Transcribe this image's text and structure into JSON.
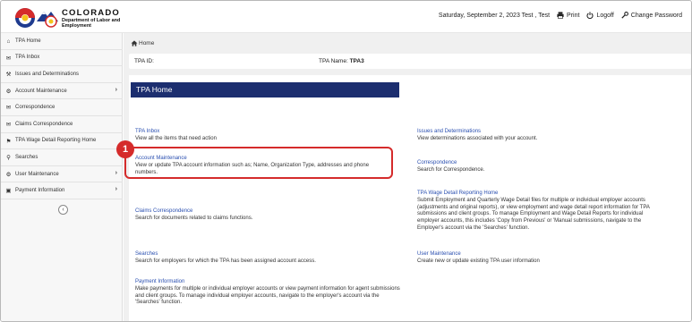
{
  "header": {
    "logo_title": "COLORADO",
    "logo_subtitle": "Department of Labor and Employment",
    "date_user": "Saturday, September 2, 2023  Test , Test",
    "print_label": "Print",
    "logoff_label": "Logoff",
    "change_password_label": "Change Password"
  },
  "sidebar": {
    "items": [
      {
        "label": "TPA Home",
        "icon": "home-icon"
      },
      {
        "label": "TPA Inbox",
        "icon": "envelope-icon"
      },
      {
        "label": "Issues and Determinations",
        "icon": "wrench-icon"
      },
      {
        "label": "Account Maintenance",
        "icon": "cogs-icon"
      },
      {
        "label": "Correspondence",
        "icon": "envelope-icon"
      },
      {
        "label": "Claims Correspondence",
        "icon": "envelope-icon"
      },
      {
        "label": "TPA Wage Detail Reporting Home",
        "icon": "flag-icon"
      },
      {
        "label": "Searches",
        "icon": "search-icon"
      },
      {
        "label": "User Maintenance",
        "icon": "cogs-icon"
      },
      {
        "label": "Payment Information",
        "icon": "money-icon"
      }
    ]
  },
  "breadcrumb": {
    "home_label": "Home"
  },
  "tpa_bar": {
    "id_label": "TPA ID:",
    "name_label": "TPA Name:",
    "name_value": "TPA3"
  },
  "page_title": "TPA Home",
  "callout_number": "1",
  "left_column": [
    {
      "link": "TPA Inbox",
      "desc": "View all the items that need action"
    },
    {
      "link": "Account Maintenance",
      "desc": "View or update TPA account information such as; Name, Organization Type, addresses and phone numbers."
    },
    {
      "link": "Claims Correspondence",
      "desc": "Search for documents related to claims functions."
    },
    {
      "link": "Searches",
      "desc": "Search for employers for which the TPA has been assigned account access."
    },
    {
      "link": "Payment Information",
      "desc": "Make payments for multiple or individual employer accounts or view payment information for agent submissions and client groups. To manage individual employer accounts, navigate to the employer's account via the 'Searches' function."
    }
  ],
  "right_column": [
    {
      "link": "Issues and Determinations",
      "desc": "View determinations associated with your account."
    },
    {
      "link": "Correspondence",
      "desc": "Search for Correspondence."
    },
    {
      "link": "TPA Wage Detail Reporting Home",
      "desc": "Submit Employment and Quarterly Wage Detail files for multiple or individual employer accounts (adjustments and original reports), or view employment and wage detail report information for TPA submissions and client groups. To manage Employment and Wage Detail Reports for individual employer accounts, this includes 'Copy from Previous' or 'Manual submissions, navigate to the Employer's account via the 'Searches' function."
    },
    {
      "link": "User Maintenance",
      "desc": "Create new or update existing TPA user information"
    }
  ],
  "colors": {
    "title_bar": "#1c2e6f",
    "link": "#2a4fb0",
    "highlight": "#d52b2b"
  }
}
